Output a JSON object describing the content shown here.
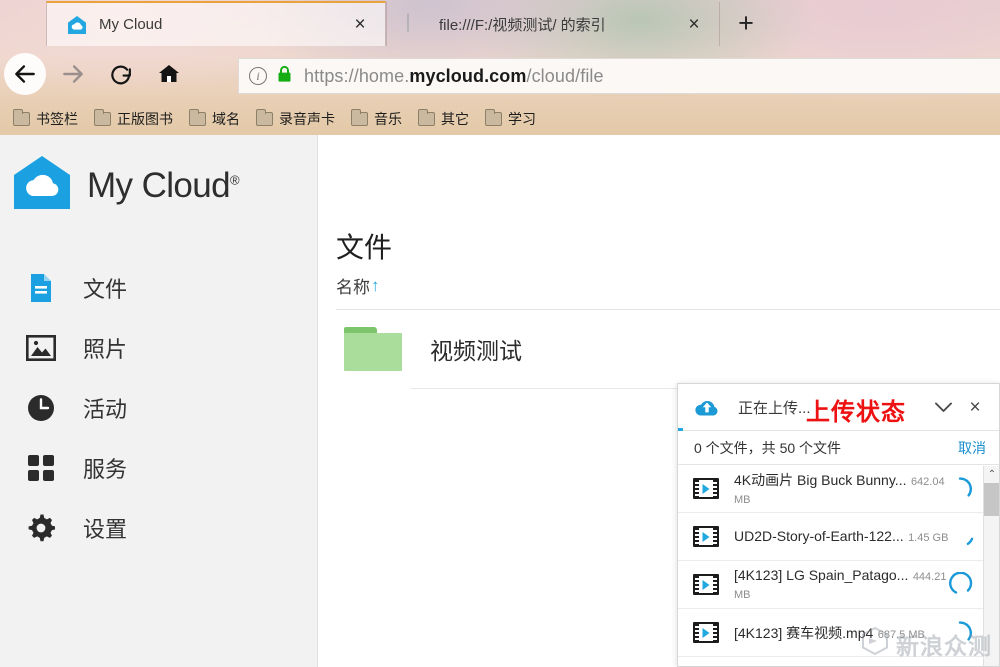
{
  "browser": {
    "tabs": [
      {
        "title": "My Cloud",
        "favicon": "cloud-house-icon",
        "active": true,
        "close_label": "×"
      },
      {
        "title": "file:///F:/视频测试/ 的索引",
        "favicon": "drive-icon",
        "active": false,
        "close_label": "×"
      }
    ],
    "new_tab_label": "+",
    "nav_buttons": [
      {
        "name": "back-button",
        "icon": "arrow-left-icon"
      },
      {
        "name": "forward-button",
        "icon": "arrow-right-icon"
      },
      {
        "name": "reload-button",
        "icon": "reload-icon"
      },
      {
        "name": "home-button",
        "icon": "home-icon"
      }
    ],
    "omnibox": {
      "info_label": "i",
      "security_icon": "lock-icon",
      "url_prefix": "https://home.",
      "url_host": "mycloud.com",
      "url_path": "/cloud/file",
      "full_url": "https://home.mycloud.com/cloud/file"
    },
    "bookmarks": [
      "书签栏",
      "正版图书",
      "域名",
      "录音声卡",
      "音乐",
      "其它",
      "学习"
    ]
  },
  "sidebar": {
    "brand_name": "My Cloud",
    "brand_reg": "®",
    "items": [
      {
        "label": "文件",
        "icon": "document-icon",
        "active": true
      },
      {
        "label": "照片",
        "icon": "photo-icon",
        "active": false
      },
      {
        "label": "活动",
        "icon": "clock-icon",
        "active": false
      },
      {
        "label": "服务",
        "icon": "grid-icon",
        "active": false
      },
      {
        "label": "设置",
        "icon": "gear-icon",
        "active": false
      }
    ]
  },
  "main": {
    "page_title": "文件",
    "column_header": "名称",
    "sort_arrow": "↑",
    "rows": [
      {
        "name": "视频测试",
        "type": "folder"
      }
    ]
  },
  "upload_panel": {
    "status_text": "正在上传...",
    "annotation": "上传状态",
    "collapse_label": "⌄",
    "close_label": "×",
    "summary": "0 个文件，共 50 个文件",
    "cancel_label": "取消",
    "scroll_up_label": "⌃",
    "items": [
      {
        "name": "4K动画片 Big Buck Bunny...",
        "size": "642.04 MB",
        "state": "uploading"
      },
      {
        "name": "UD2D-Story-of-Earth-122...",
        "size": "1.45 GB",
        "state": "uploading"
      },
      {
        "name": "[4K123] LG Spain_Patago...",
        "size": "444.21 MB",
        "state": "uploading"
      },
      {
        "name": "[4K123] 赛车视频.mp4",
        "size": "687.5 MB",
        "state": "uploading"
      }
    ]
  },
  "watermark": {
    "text": "新浪众测"
  },
  "colors": {
    "brand_blue": "#22a7e0",
    "accent_red": "#ee1111",
    "folder_green": "#aadd9b",
    "link_blue": "#1a8fd0",
    "tab_highlight": "#e8a33d"
  }
}
